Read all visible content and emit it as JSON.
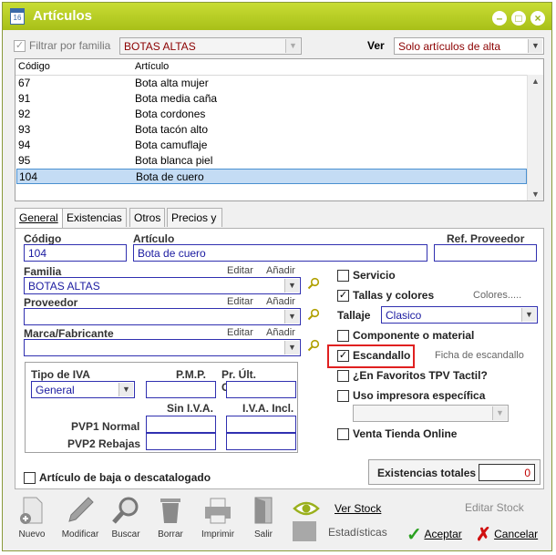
{
  "window": {
    "title": "Artículos",
    "icon_text": "16"
  },
  "filter": {
    "checkbox_label": "Filtrar por familia",
    "family_value": "BOTAS ALTAS",
    "ver_label": "Ver",
    "ver_value": "Solo artículos de alta"
  },
  "list": {
    "col_codigo": "Código",
    "col_articulo": "Artículo",
    "rows": [
      {
        "codigo": "67",
        "articulo": "Bota alta mujer"
      },
      {
        "codigo": "91",
        "articulo": "Bota media caña"
      },
      {
        "codigo": "92",
        "articulo": "Bota cordones"
      },
      {
        "codigo": "93",
        "articulo": "Bota tacón alto"
      },
      {
        "codigo": "94",
        "articulo": "Bota camuflaje"
      },
      {
        "codigo": "95",
        "articulo": "Bota blanca piel"
      },
      {
        "codigo": "104",
        "articulo": "Bota de cuero"
      }
    ],
    "selected_index": 6
  },
  "tabs": [
    "General",
    "Existencias",
    "Otros",
    "Precios y ubicación"
  ],
  "general": {
    "codigo_label": "Código",
    "codigo_value": "104",
    "articulo_label": "Artículo",
    "articulo_value": "Bota de cuero",
    "ref_label": "Ref. Proveedor",
    "ref_value": "",
    "familia_label": "Familia",
    "familia_value": "BOTAS ALTAS",
    "proveedor_label": "Proveedor",
    "proveedor_value": "",
    "marca_label": "Marca/Fabricante",
    "marca_value": "",
    "editar": "Editar",
    "anadir": "Añadir",
    "tipo_iva_label": "Tipo de IVA",
    "tipo_iva_value": "General",
    "pmp_label": "P.M.P.",
    "pr_ult_label": "Pr. Últ. Compra",
    "sin_iva_label": "Sin I.V.A.",
    "con_iva_label": "I.V.A. Incl.",
    "pvp1_label": "PVP1 Normal",
    "pvp2_label": "PVP2 Rebajas",
    "baja_label": "Artículo de baja o descatalogado",
    "servicio_label": "Servicio",
    "tallas_label": "Tallas y colores",
    "colores_link": "Colores.....",
    "tallaje_label": "Tallaje",
    "tallaje_value": "Clasico",
    "componente_label": "Componente o material",
    "escandallo_label": "Escandallo",
    "ficha_link": "Ficha de escandallo",
    "favoritos_label": "¿En Favoritos TPV Tactil?",
    "impresora_label": "Uso impresora específica",
    "venta_label": "Venta Tienda Online",
    "existencias_label": "Existencias totales",
    "existencias_value": "0"
  },
  "toolbar": {
    "nuevo": "Nuevo",
    "modificar": "Modificar",
    "buscar": "Buscar",
    "borrar": "Borrar",
    "imprimir": "Imprimir",
    "salir": "Salir",
    "ver_stock": "Ver Stock",
    "editar_stock": "Editar Stock",
    "estadisticas": "Estadísticas",
    "aceptar": "Aceptar",
    "cancelar": "Cancelar"
  },
  "colors": {
    "titlebar": "#b4cc20",
    "selection": "#c4dcf4",
    "field_border": "#3030b0",
    "highlight_box": "#e02020"
  }
}
